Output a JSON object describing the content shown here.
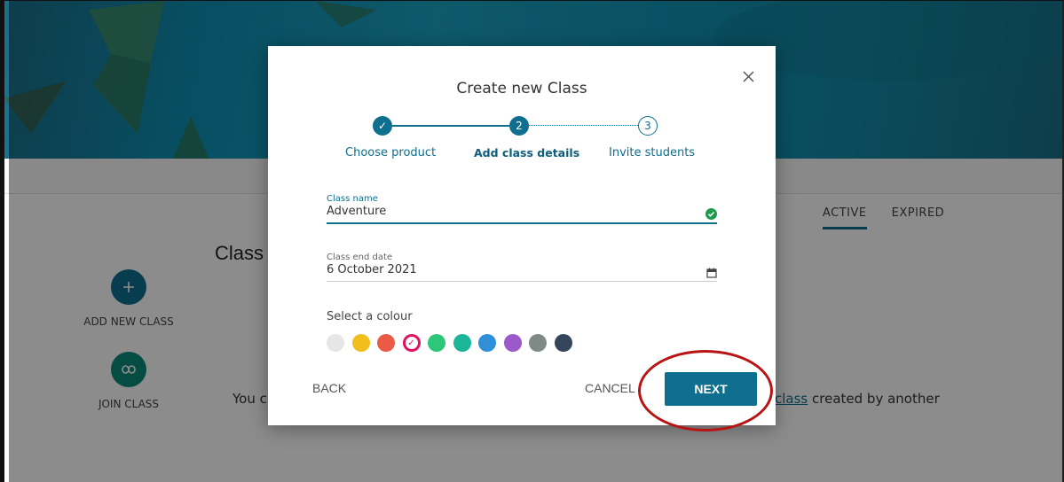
{
  "page": {
    "classes_title": "Class",
    "tabs": [
      {
        "label": "ACTIVE",
        "active": true
      },
      {
        "label": "EXPIRED",
        "active": false
      }
    ],
    "side_actions": [
      {
        "label": "ADD NEW CLASS",
        "icon": "plus-icon",
        "color": "#0e6f8f"
      },
      {
        "label": "JOIN CLASS",
        "icon": "link-icon",
        "color": "#0a8a78"
      }
    ],
    "bottom_text_left": "You c",
    "bottom_link": "class",
    "bottom_text_right": " created by another"
  },
  "modal": {
    "title": "Create new Class",
    "close_icon": "close-icon",
    "steps": [
      {
        "marker": "✓",
        "label": "Choose product",
        "state": "done"
      },
      {
        "marker": "2",
        "label": "Add class details",
        "state": "current"
      },
      {
        "marker": "3",
        "label": "Invite students",
        "state": "todo"
      }
    ],
    "class_name": {
      "label": "Class name",
      "value": "Adventure",
      "status_icon": "check-circle-icon"
    },
    "class_end_date": {
      "label": "Class end date",
      "value": "6 October 2021",
      "icon": "calendar-icon"
    },
    "colour": {
      "label": "Select a colour",
      "options": [
        "#e6e6e6",
        "#f2be1c",
        "#ea5a45",
        "#e0115f",
        "#2ec77a",
        "#1bb59a",
        "#2f8fd8",
        "#9b59c9",
        "#7f8a88",
        "#34455c"
      ],
      "selected_index": 3,
      "selected_mark": "✓"
    },
    "buttons": {
      "back": "BACK",
      "cancel": "CANCEL",
      "next": "NEXT"
    }
  },
  "colors": {
    "accent": "#0e6f8f",
    "highlight": "#b81414"
  }
}
